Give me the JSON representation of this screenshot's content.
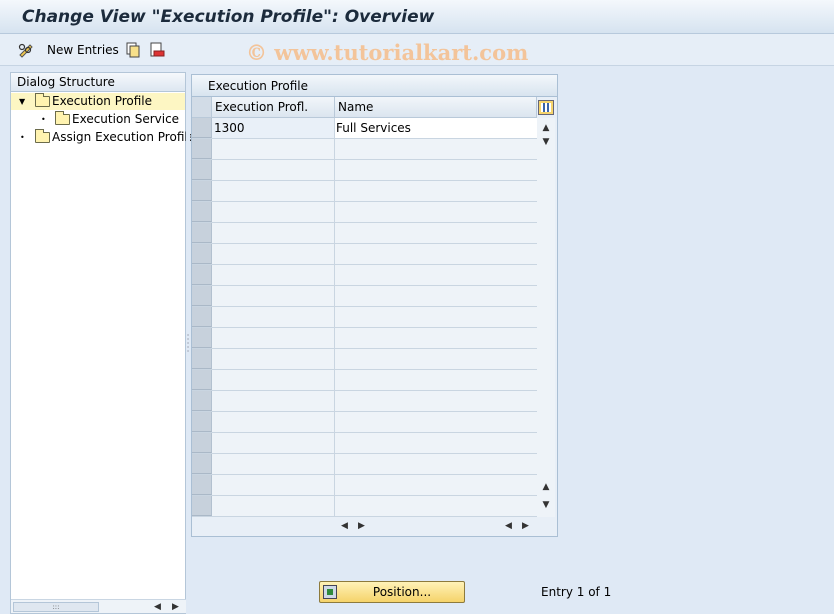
{
  "window": {
    "title": "Change View \"Execution Profile\": Overview"
  },
  "toolbar": {
    "new_entries_label": "New Entries",
    "watermark": "© www.tutorialkart.com",
    "icons": [
      "glasses-pencil-icon",
      "copy-icon",
      "delete-icon"
    ]
  },
  "dialog_structure": {
    "header": "Dialog Structure",
    "items": [
      {
        "label": "Execution Profile",
        "level": 0,
        "expanded": true,
        "selected": true
      },
      {
        "label": "Execution Service",
        "level": 1,
        "expanded": false,
        "selected": false
      },
      {
        "label": "Assign Execution Profile",
        "level": 0,
        "expanded": false,
        "selected": false
      }
    ]
  },
  "table": {
    "caption": "Execution Profile",
    "columns": [
      "Execution Profl.",
      "Name"
    ],
    "rows": [
      {
        "profile": "1300",
        "name": "Full Services"
      }
    ]
  },
  "footer": {
    "position_button_label": "Position...",
    "entry_info": "Entry 1 of 1"
  },
  "colors": {
    "background": "#dfe9f5",
    "selected_tree_item": "#fdf6c3",
    "button_yellow": "#f5d36a"
  }
}
